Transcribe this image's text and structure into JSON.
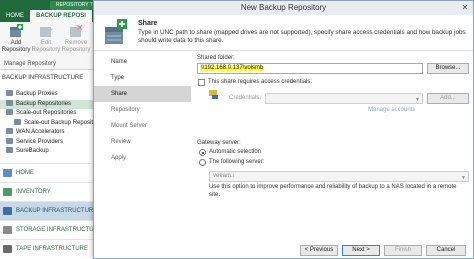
{
  "app": {
    "context_tab": "REPOSITORY TOO",
    "tabs": [
      "HOME",
      "BACKUP REPOSI"
    ],
    "ribbon": {
      "buttons": [
        {
          "label": "Add Repository",
          "enabled": true
        },
        {
          "label": "Edit Repository",
          "enabled": false
        },
        {
          "label": "Remove Repository",
          "enabled": false
        }
      ],
      "group_label": "Manage Repository"
    },
    "tree_header": "BACKUP INFRASTRUCTURE",
    "tree_items": [
      {
        "label": "Backup Proxies",
        "indent": 1,
        "selected": false
      },
      {
        "label": "Backup Repositories",
        "indent": 1,
        "selected": true
      },
      {
        "label": "Scale-out Repositories",
        "indent": 1,
        "selected": false
      },
      {
        "label": "Scale-out Backup Repositor",
        "indent": 2,
        "selected": false
      },
      {
        "label": "WAN Accelerators",
        "indent": 1,
        "selected": false
      },
      {
        "label": "Service Providers",
        "indent": 1,
        "selected": false
      },
      {
        "label": "SureBackup",
        "indent": 1,
        "selected": false
      }
    ],
    "nav_items": [
      {
        "label": "HOME",
        "active": false,
        "icon_color": "#5a8fc4"
      },
      {
        "label": "INVENTORY",
        "active": false,
        "icon_color": "#4a9a6a"
      },
      {
        "label": "BACKUP INFRASTRUCTURE",
        "active": true,
        "icon_color": "#3d6fa3"
      },
      {
        "label": "STORAGE INFRASTRUCTURE",
        "active": false,
        "icon_color": "#8a8a8a"
      },
      {
        "label": "TAPE INFRASTRUCTURE",
        "active": false,
        "icon_color": "#6a6a6a"
      }
    ]
  },
  "dialog": {
    "title": "New Backup Repository",
    "close_glyph": "✕",
    "header": {
      "title": "Share",
      "description": "Type in UNC path to share (mapped drives are not supported), specify share access credentials and how backup jobs should write data to this share."
    },
    "steps": [
      {
        "label": "Name",
        "state": "done"
      },
      {
        "label": "Type",
        "state": "done"
      },
      {
        "label": "Share",
        "state": "active"
      },
      {
        "label": "Repository",
        "state": "future"
      },
      {
        "label": "Mount Server",
        "state": "future"
      },
      {
        "label": "Review",
        "state": "future"
      },
      {
        "label": "Apply",
        "state": "future"
      }
    ],
    "share": {
      "folder_label": "Shared folder:",
      "folder_value": "\\\\192.168.0.137\\volsmb",
      "browse_label": "Browse...",
      "requires_credentials_label": "This share requires access credentials:",
      "requires_credentials_checked": false,
      "credentials_label": "Credentials:",
      "credentials_value": "",
      "add_label": "Add...",
      "manage_accounts_label": "Manage accounts"
    },
    "gateway": {
      "label": "Gateway server:",
      "automatic_label": "Automatic selection",
      "following_label": "The following server:",
      "selected": "automatic",
      "server_value": "veeam.i",
      "note": "Use this option to improve performance and reliability of backup to a NAS located in a remote site."
    },
    "footer": {
      "previous_label": "< Previous",
      "next_label": "Next >",
      "finish_label": "Finish",
      "cancel_label": "Cancel"
    }
  },
  "colors": {
    "app_green": "#1f6b3c",
    "highlight": "#ffff3a",
    "selection": "#d5d5d5",
    "link": "#3a6fb0"
  }
}
